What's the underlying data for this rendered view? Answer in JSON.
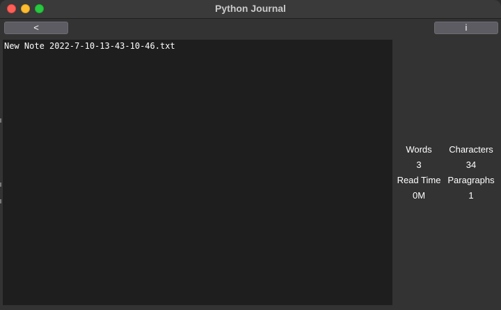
{
  "window": {
    "title": "Python Journal"
  },
  "toolbar": {
    "back_label": "<",
    "info_label": "i"
  },
  "editor": {
    "content": "New Note 2022-7-10-13-43-10-46.txt"
  },
  "stats": {
    "words_label": "Words",
    "characters_label": "Characters",
    "words_value": "3",
    "characters_value": "34",
    "read_time_label": "Read Time",
    "paragraphs_label": "Paragraphs",
    "read_time_value": "0M",
    "paragraphs_value": "1"
  },
  "colors": {
    "window_bg": "#333333",
    "editor_bg": "#1e1e1e",
    "button_bg": "#5d5c63",
    "close": "#ff5f57",
    "minimize": "#febc2e",
    "zoom": "#28c840"
  }
}
